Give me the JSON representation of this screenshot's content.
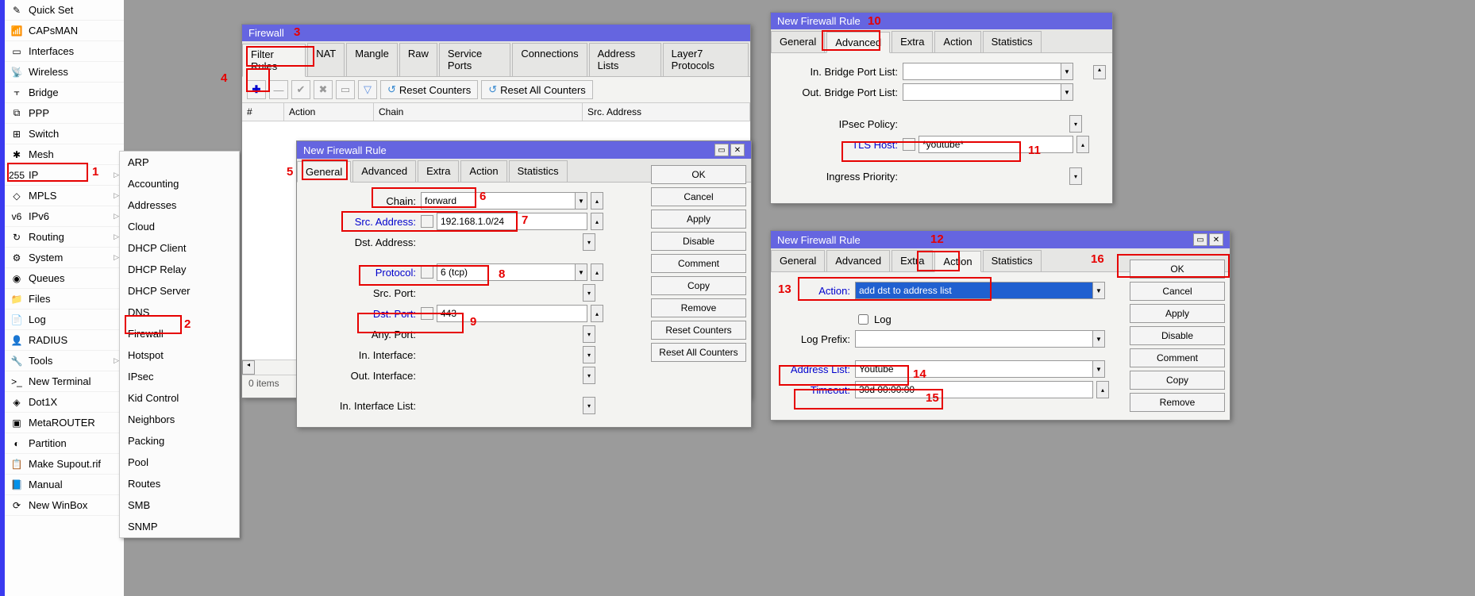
{
  "sidebar": {
    "items": [
      {
        "label": "Quick Set",
        "icon": "✎"
      },
      {
        "label": "CAPsMAN",
        "icon": "📶"
      },
      {
        "label": "Interfaces",
        "icon": "▭"
      },
      {
        "label": "Wireless",
        "icon": "📡"
      },
      {
        "label": "Bridge",
        "icon": "⫟"
      },
      {
        "label": "PPP",
        "icon": "⧉"
      },
      {
        "label": "Switch",
        "icon": "⊞"
      },
      {
        "label": "Mesh",
        "icon": "✱"
      },
      {
        "label": "IP",
        "icon": "255",
        "arrow": true
      },
      {
        "label": "MPLS",
        "icon": "◇",
        "arrow": true
      },
      {
        "label": "IPv6",
        "icon": "v6",
        "arrow": true
      },
      {
        "label": "Routing",
        "icon": "↻",
        "arrow": true
      },
      {
        "label": "System",
        "icon": "⚙",
        "arrow": true
      },
      {
        "label": "Queues",
        "icon": "◉"
      },
      {
        "label": "Files",
        "icon": "📁"
      },
      {
        "label": "Log",
        "icon": "📄"
      },
      {
        "label": "RADIUS",
        "icon": "👤"
      },
      {
        "label": "Tools",
        "icon": "🔧",
        "arrow": true
      },
      {
        "label": "New Terminal",
        "icon": ">_"
      },
      {
        "label": "Dot1X",
        "icon": "◈"
      },
      {
        "label": "MetaROUTER",
        "icon": "▣"
      },
      {
        "label": "Partition",
        "icon": "◐"
      },
      {
        "label": "Make Supout.rif",
        "icon": "📋"
      },
      {
        "label": "Manual",
        "icon": "📘"
      },
      {
        "label": "New WinBox",
        "icon": "⟳"
      }
    ]
  },
  "submenu": {
    "items": [
      "ARP",
      "Accounting",
      "Addresses",
      "Cloud",
      "DHCP Client",
      "DHCP Relay",
      "DHCP Server",
      "DNS",
      "Firewall",
      "Hotspot",
      "IPsec",
      "Kid Control",
      "Neighbors",
      "Packing",
      "Pool",
      "Routes",
      "SMB",
      "SNMP"
    ]
  },
  "fw_win": {
    "title": "Firewall",
    "tabs": [
      "Filter Rules",
      "NAT",
      "Mangle",
      "Raw",
      "Service Ports",
      "Connections",
      "Address Lists",
      "Layer7 Protocols"
    ],
    "reset1": "Reset Counters",
    "reset2": "Reset All Counters",
    "cols": [
      "#",
      "Action",
      "Chain",
      "Src. Address"
    ],
    "status": "0 items"
  },
  "rule_general": {
    "title": "New Firewall Rule",
    "tabs": [
      "General",
      "Advanced",
      "Extra",
      "Action",
      "Statistics"
    ],
    "chain_lbl": "Chain:",
    "chain_val": "forward",
    "src_lbl": "Src. Address:",
    "src_val": "192.168.1.0/24",
    "dst_lbl": "Dst. Address:",
    "proto_lbl": "Protocol:",
    "proto_val": "6 (tcp)",
    "sport_lbl": "Src. Port:",
    "dport_lbl": "Dst. Port:",
    "dport_val": "443",
    "aport_lbl": "Any. Port:",
    "inif_lbl": "In. Interface:",
    "outif_lbl": "Out. Interface:",
    "iniflist_lbl": "In. Interface List:",
    "buttons": [
      "OK",
      "Cancel",
      "Apply",
      "Disable",
      "Comment",
      "Copy",
      "Remove",
      "Reset Counters",
      "Reset All Counters"
    ]
  },
  "rule_advanced": {
    "title": "New Firewall Rule",
    "tabs": [
      "General",
      "Advanced",
      "Extra",
      "Action",
      "Statistics"
    ],
    "inbpl_lbl": "In. Bridge Port List:",
    "outbpl_lbl": "Out. Bridge Port List:",
    "ipsec_lbl": "IPsec Policy:",
    "tls_lbl": "TLS Host:",
    "tls_val": "*youtube*",
    "ingress_lbl": "Ingress Priority:"
  },
  "rule_action": {
    "title": "New Firewall Rule",
    "tabs": [
      "General",
      "Advanced",
      "Extra",
      "Action",
      "Statistics"
    ],
    "action_lbl": "Action:",
    "action_val": "add dst to address list",
    "log_lbl": "Log",
    "logprefix_lbl": "Log Prefix:",
    "addrlist_lbl": "Address List:",
    "addrlist_val": "Youtube",
    "timeout_lbl": "Timeout:",
    "timeout_val": "30d 00:00:00",
    "buttons": [
      "OK",
      "Cancel",
      "Apply",
      "Disable",
      "Comment",
      "Copy",
      "Remove"
    ]
  },
  "ann": {
    "n1": "1",
    "n2": "2",
    "n3": "3",
    "n4": "4",
    "n5": "5",
    "n6": "6",
    "n7": "7",
    "n8": "8",
    "n9": "9",
    "n10": "10",
    "n11": "11",
    "n12": "12",
    "n13": "13",
    "n14": "14",
    "n15": "15",
    "n16": "16"
  }
}
